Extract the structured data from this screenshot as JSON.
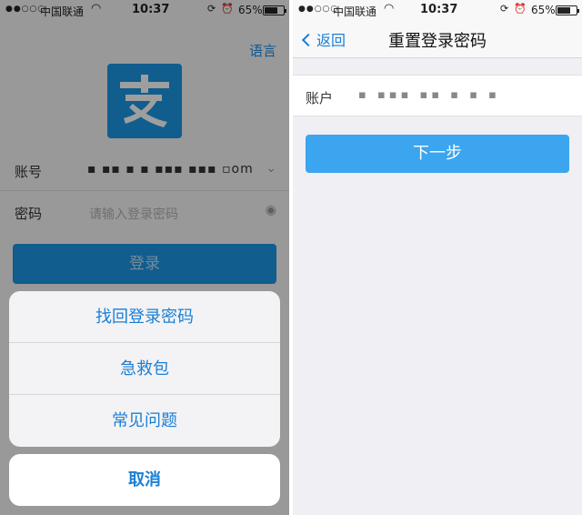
{
  "status_left": {
    "carrier": "中国联通",
    "time": "10:37",
    "battery": "65%",
    "signal": "●●○○○"
  },
  "status_right": {
    "carrier": "中国联通",
    "time": "10:37",
    "battery": "65%",
    "signal": "●●○○○"
  },
  "login": {
    "language_link": "语言",
    "logo_char": "支",
    "account_label": "账号",
    "account_value": "▪ ▪▪ ▪ ▪ ▪▪▪ ▪▪▪ ▫om",
    "password_label": "密码",
    "password_placeholder": "请输入登录密码",
    "login_button": "登录"
  },
  "action_sheet": {
    "items": [
      "找回登录密码",
      "急救包",
      "常见问题"
    ],
    "cancel": "取消"
  },
  "reset": {
    "back_label": "返回",
    "title": "重置登录密码",
    "account_label": "账户",
    "account_value": "▪ ▪▪▪ ▪▪ ▪ ▪ ▪",
    "next_button": "下一步"
  },
  "colors": {
    "accent": "#1a96e6",
    "link": "#1a7fd6",
    "background": "#efeff4"
  },
  "icons": {
    "wifi": "wifi-icon",
    "alarm": "alarm-icon",
    "lock": "rotation-lock-icon",
    "dropdown": "chevron-down-icon",
    "eye": "eye-icon",
    "back": "chevron-left-icon"
  }
}
